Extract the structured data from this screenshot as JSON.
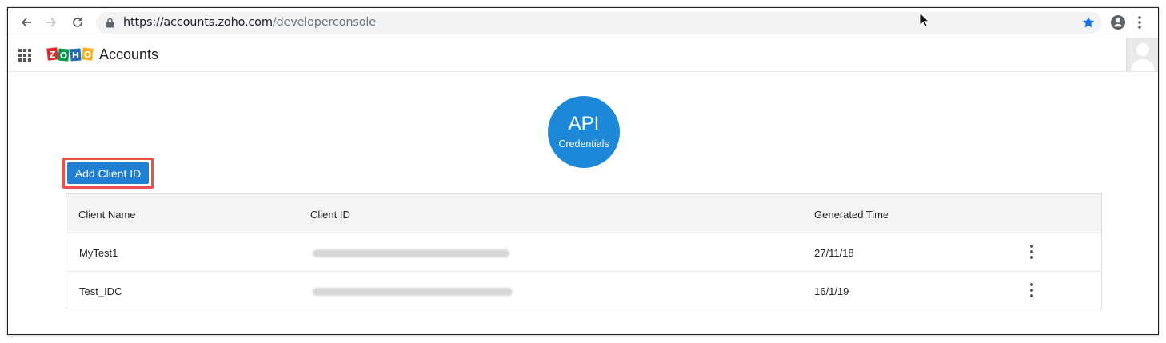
{
  "browser": {
    "url_host": "https://accounts.zoho.com",
    "url_path": "/developerconsole"
  },
  "appbar": {
    "title": "Accounts",
    "logo_letters": [
      "Z",
      "O",
      "H",
      "O"
    ],
    "logo_colors": [
      "#e42527",
      "#089949",
      "#226db4",
      "#f9b21d"
    ]
  },
  "badge": {
    "big": "API",
    "small": "Credentials",
    "color": "#1e88d8"
  },
  "add_button": {
    "label": "Add Client ID",
    "color": "#1f7fd2",
    "highlight_color": "#e9524a"
  },
  "table": {
    "headers": [
      "Client Name",
      "Client ID",
      "Generated Time"
    ],
    "rows": [
      {
        "name": "MyTest1",
        "client_id": "",
        "generated": "27/11/18"
      },
      {
        "name": "Test_IDC",
        "client_id": "",
        "generated": "16/1/19"
      }
    ]
  }
}
